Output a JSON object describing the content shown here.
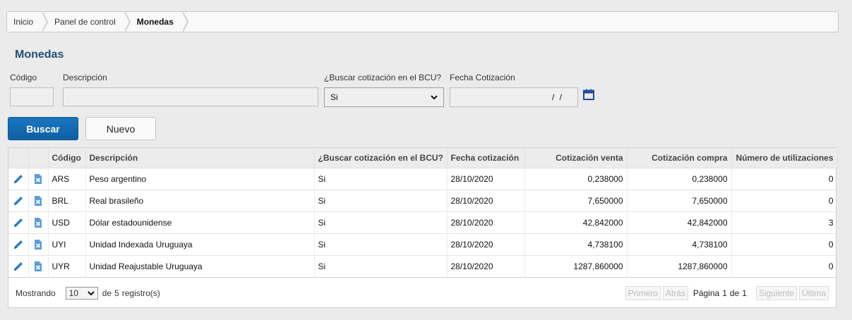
{
  "breadcrumb": [
    "Inicio",
    "Panel de control",
    "Monedas"
  ],
  "page_title": "Monedas",
  "filters": {
    "codigo_label": "Código",
    "descripcion_label": "Descripción",
    "bcu_label": "¿Buscar cotización en el BCU?",
    "bcu_value": "Si",
    "fecha_label": "Fecha Cotización",
    "fecha_value": "/ /"
  },
  "buttons": {
    "buscar": "Buscar",
    "nuevo": "Nuevo"
  },
  "table": {
    "columns": [
      "Código",
      "Descripción",
      "¿Buscar cotización en el BCU?",
      "Fecha cotización",
      "Cotización venta",
      "Cotización compra",
      "Número de utilizaciones"
    ],
    "rows": [
      [
        "ARS",
        "Peso argentino",
        "Si",
        "28/10/2020",
        "0,238000",
        "0,238000",
        "0"
      ],
      [
        "BRL",
        "Real brasileño",
        "Si",
        "28/10/2020",
        "7,650000",
        "7,650000",
        "0"
      ],
      [
        "USD",
        "Dólar estadounidense",
        "Si",
        "28/10/2020",
        "42,842000",
        "42,842000",
        "3"
      ],
      [
        "UYI",
        "Unidad Indexada Uruguaya",
        "Si",
        "28/10/2020",
        "4,738100",
        "4,738100",
        "0"
      ],
      [
        "UYR",
        "Unidad Reajustable Uruguaya",
        "Si",
        "28/10/2020",
        "1287,860000",
        "1287,860000",
        "0"
      ]
    ]
  },
  "pager": {
    "mostrando": "Mostrando",
    "page_size": "10",
    "de": "de",
    "total": "5",
    "registros": "registro(s)",
    "primero": "Primero",
    "atras": "Atrás",
    "pagina": "Página",
    "current": "1",
    "de2": "de",
    "pages": "1",
    "siguiente": "Siguiente",
    "ultima": "Última"
  },
  "colors": {
    "accent": "#1f4e79",
    "primary_button": "#1468b0",
    "icon_blue": "#2d7fc9"
  },
  "icons": {
    "edit": "pencil-icon",
    "delete": "delete-file-icon",
    "calendar": "calendar-icon",
    "chevron": "chevron-down-icon"
  }
}
